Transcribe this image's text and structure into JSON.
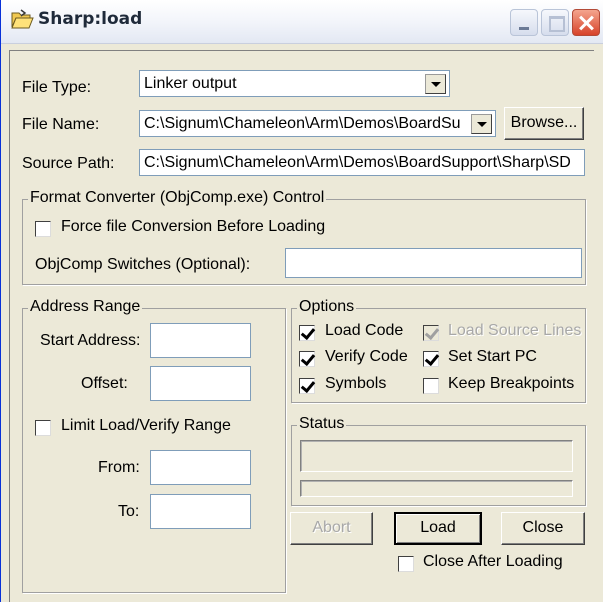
{
  "window": {
    "title": "Sharp:load"
  },
  "icons": {
    "title_icon": "folder-open-icon"
  },
  "file_type": {
    "label": "File Type:",
    "value": "Linker output"
  },
  "file_name": {
    "label": "File Name:",
    "value": "C:\\Signum\\Chameleon\\Arm\\Demos\\BoardSu",
    "browse_label": "Browse..."
  },
  "source_path": {
    "label": "Source Path:",
    "value": "C:\\Signum\\Chameleon\\Arm\\Demos\\BoardSupport\\Sharp\\SD"
  },
  "format_converter": {
    "title": "Format Converter (ObjComp.exe) Control",
    "force_conversion_label": "Force file Conversion Before Loading",
    "force_conversion_checked": false,
    "switches_label": "ObjComp Switches (Optional):",
    "switches_value": ""
  },
  "address_range": {
    "title": "Address Range",
    "start_address_label": "Start Address:",
    "start_address_value": "",
    "offset_label": "Offset:",
    "offset_value": "",
    "limit_label": "Limit Load/Verify Range",
    "limit_checked": false,
    "from_label": "From:",
    "from_value": "",
    "to_label": "To:",
    "to_value": ""
  },
  "options": {
    "title": "Options",
    "load_code": {
      "label": "Load Code",
      "checked": true
    },
    "load_source_lines": {
      "label": "Load Source Lines",
      "checked": true,
      "disabled": true
    },
    "verify_code": {
      "label": "Verify Code",
      "checked": true
    },
    "set_start_pc": {
      "label": "Set Start PC",
      "checked": true
    },
    "symbols": {
      "label": "Symbols",
      "checked": true
    },
    "keep_breakpoints": {
      "label": "Keep Breakpoints",
      "checked": false
    }
  },
  "status": {
    "title": "Status",
    "text": "",
    "progress": 0
  },
  "buttons": {
    "abort": "Abort",
    "load": "Load",
    "close": "Close"
  },
  "close_after_loading": {
    "label": "Close After Loading",
    "checked": false
  },
  "colors": {
    "titlebar_text": "#1f2a3a",
    "dialog_face": "#ece9d8",
    "close_button": "#d7432a"
  }
}
